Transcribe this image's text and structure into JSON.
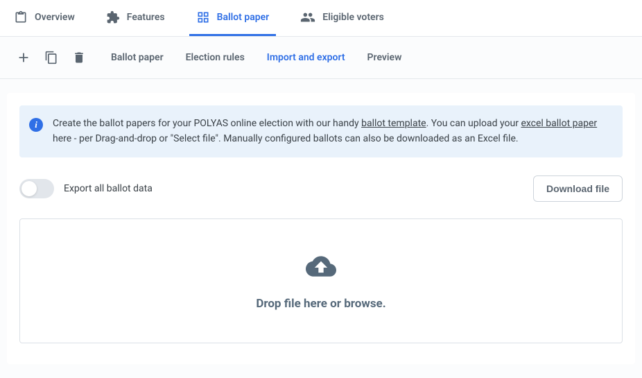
{
  "topTabs": {
    "overview": "Overview",
    "features": "Features",
    "ballotPaper": "Ballot paper",
    "eligibleVoters": "Eligible voters"
  },
  "subTabs": {
    "ballotPaper": "Ballot paper",
    "electionRules": "Election rules",
    "importExport": "Import and export",
    "preview": "Preview"
  },
  "info": {
    "seg1": "Create the ballot papers for your POLYAS online election with our handy ",
    "link1": "ballot template",
    "seg2": ". You can upload your ",
    "link2": "excel ballot paper",
    "seg3": " here - per Drag-and-drop or \"Select file\". Manually configured ballots can also be downloaded as an Excel file."
  },
  "exportToggleLabel": "Export all ballot data",
  "downloadButton": "Download file",
  "dropzoneText": "Drop file here or browse."
}
